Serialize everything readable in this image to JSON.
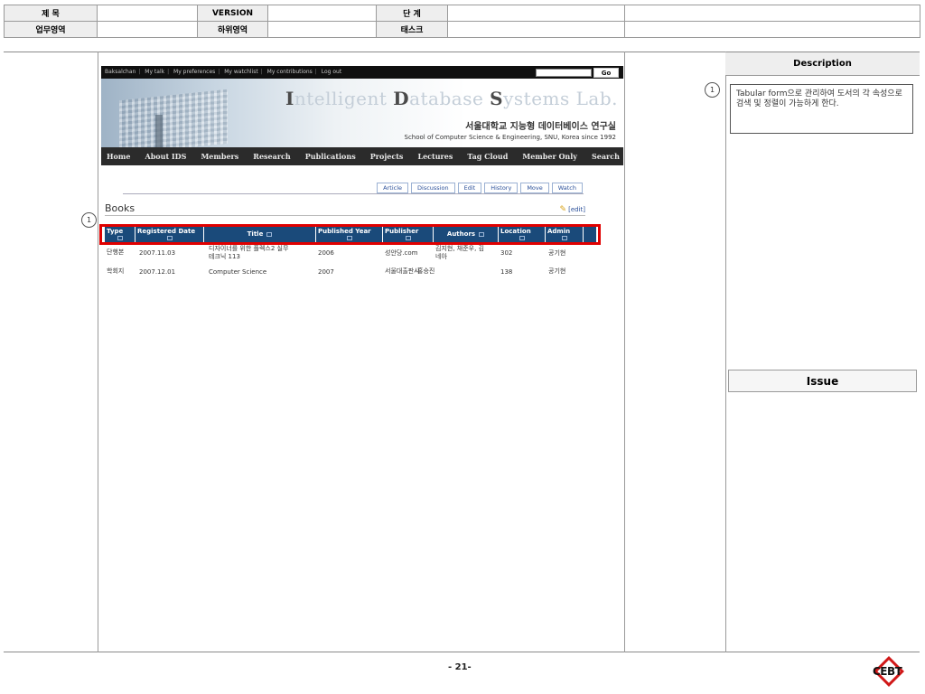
{
  "header": {
    "title_label": "제 목",
    "version_label": "VERSION",
    "stage_label": "단 계",
    "business_area_label": "업무영역",
    "sub_area_label": "하위영역",
    "task_label": "태스크",
    "title_value": "",
    "version_value": "",
    "stage_value": "",
    "business_area_value": "",
    "sub_area_value": "",
    "task_value": ""
  },
  "site": {
    "user_links": [
      "Baksalchan",
      "My talk",
      "My preferences",
      "My watchlist",
      "My contributions",
      "Log out"
    ],
    "go_label": "Go",
    "banner_title": {
      "i": "I",
      "ntelligent": "ntelligent ",
      "d": "D",
      "atabase": "atabase ",
      "s": "S",
      "ystems": "ystems Lab."
    },
    "banner_korean": "서울대학교 지능형 데이터베이스 연구실",
    "banner_english": "School of Computer Science & Engineering, SNU, Korea since 1992",
    "nav": [
      "Home",
      "About IDS",
      "Members",
      "Research",
      "Publications",
      "Projects",
      "Lectures",
      "Tag Cloud",
      "Member Only",
      "Search"
    ],
    "tabs": [
      "Article",
      "Discussion",
      "Edit",
      "History",
      "Move",
      "Watch"
    ],
    "page_title": "Books",
    "edit_link": "[edit]",
    "columns": [
      "Type",
      "Registered Date",
      "Title",
      "Published Year",
      "Publisher",
      "Authors",
      "Location",
      "Admin"
    ],
    "rows": [
      {
        "type": "단행본",
        "date": "2007.11.03",
        "title1": "디자이너를 위한 플렉스2 실무",
        "title2": "테크닉 113",
        "year": "2006",
        "publisher": "성안당.com",
        "authors1": "김지현, 채준우, 김",
        "authors2": "네아",
        "location": "302",
        "admin": "공기현"
      },
      {
        "type": "학회지",
        "date": "2007.12.01",
        "title1": "Computer Science",
        "title2": "",
        "year": "2007",
        "publisher": "서울대출판사",
        "authors1": "홍승진",
        "authors2": "",
        "location": "138",
        "admin": "공기현"
      }
    ]
  },
  "callout_number": "1",
  "description": {
    "header": "Description",
    "text": "Tabular form으로 관리하여 도서의 각 속성으로 검색 및 정렬이 가능하게 한다."
  },
  "issue": {
    "header": "Issue"
  },
  "page_number": "- 21-",
  "logo_text": "CEBT"
}
